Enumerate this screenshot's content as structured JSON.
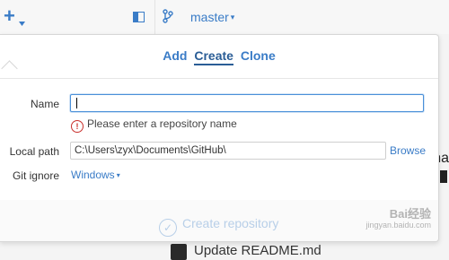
{
  "toolbar": {
    "add_icon": "plus-icon",
    "caret": "▾",
    "branch_name": "master"
  },
  "popover": {
    "tabs": [
      {
        "label": "Add"
      },
      {
        "label": "Create"
      },
      {
        "label": "Clone"
      }
    ],
    "name_label": "Name",
    "name_value": "",
    "error_text": "Please enter a repository name",
    "local_path_label": "Local path",
    "local_path_value": "C:\\Users\\zyx\\Documents\\GitHub\\",
    "browse_label": "Browse",
    "gitignore_label": "Git ignore",
    "gitignore_value": "Windows",
    "create_button": "Create repository"
  },
  "background": {
    "peek_text": "ha",
    "commit_message": "Update README.md"
  },
  "watermark": {
    "text": "Bai经验",
    "sub": "jingyan.baidu.com"
  },
  "colors": {
    "accent": "#3a7cc7",
    "error": "#c9302c",
    "disabled": "#b8cfe8"
  }
}
